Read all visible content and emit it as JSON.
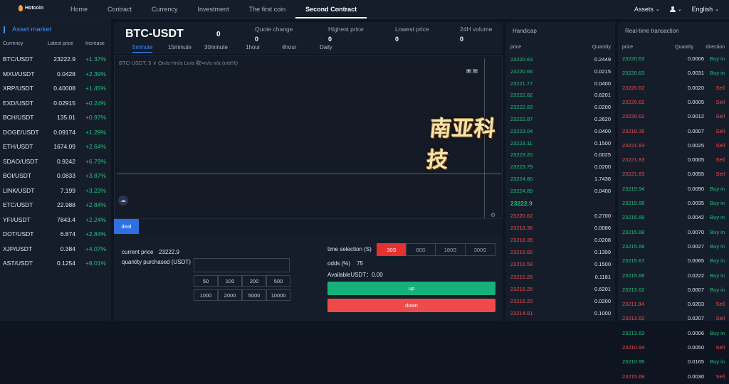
{
  "brand": {
    "name": "Hotcoin"
  },
  "nav": {
    "items": [
      "Home",
      "Contract",
      "Currency",
      "Investment",
      "The first coin",
      "Second Contract"
    ],
    "active": "Second Contract"
  },
  "topright": {
    "assets": "Assets",
    "language": "English"
  },
  "market": {
    "title": "Asset market",
    "headers": {
      "currency": "Currency",
      "price": "Latest price",
      "increase": "Increase"
    },
    "rows": [
      {
        "sym": "BTC/USDT",
        "price": "23222.9",
        "chg": "+1.37%"
      },
      {
        "sym": "MXU/USDT",
        "price": "0.0428",
        "chg": "+2.39%"
      },
      {
        "sym": "XRP/USDT",
        "price": "0.40008",
        "chg": "+1.45%"
      },
      {
        "sym": "EXD/USDT",
        "price": "0.02915",
        "chg": "+0.24%"
      },
      {
        "sym": "BCH/USDT",
        "price": "135.01",
        "chg": "+0.97%"
      },
      {
        "sym": "DOGE/USDT",
        "price": "0.09174",
        "chg": "+1.29%"
      },
      {
        "sym": "ETH/USDT",
        "price": "1674.09",
        "chg": "+2.64%"
      },
      {
        "sym": "SDAO/USDT",
        "price": "0.9242",
        "chg": "+6.79%"
      },
      {
        "sym": "BOI/USDT",
        "price": "0.0833",
        "chg": "+3.87%"
      },
      {
        "sym": "LINK/USDT",
        "price": "7.199",
        "chg": "+3.23%"
      },
      {
        "sym": "ETC/USDT",
        "price": "22.988",
        "chg": "+2.84%"
      },
      {
        "sym": "YFI/USDT",
        "price": "7843.4",
        "chg": "+2.24%"
      },
      {
        "sym": "DOT/USDT",
        "price": "6.874",
        "chg": "+2.84%"
      },
      {
        "sym": "XJP/USDT",
        "price": "0.384",
        "chg": "+4.07%"
      },
      {
        "sym": "AST/USDT",
        "price": "0.1254",
        "chg": "+8.01%"
      }
    ]
  },
  "header": {
    "pair": "BTC-USDT",
    "value": "0",
    "stats": [
      {
        "label": "Quote change",
        "value": "0"
      },
      {
        "label": "Highest price",
        "value": "0"
      },
      {
        "label": "Lowest price",
        "value": "0"
      },
      {
        "label": "24H volume",
        "value": "0"
      }
    ],
    "timeframes": [
      "5minute",
      "15minute",
      "30minute",
      "1hour",
      "4hour",
      "Daily"
    ],
    "active_tf": "5minute"
  },
  "chart": {
    "info": "BTC-USDT, 5 ∨   On/a  Hn/a  Ln/a  收=n/a  n/a (n/a%)"
  },
  "watermark": {
    "text": "南亚科技"
  },
  "deal": {
    "tab": "deal",
    "current_price_label": "current price",
    "current_price": "23222.9",
    "qty_label": "quantity purchased (USDT)",
    "qty_value": "",
    "quick": [
      "50",
      "100",
      "200",
      "500",
      "1000",
      "2000",
      "5000",
      "10000"
    ],
    "time_label": "time selection (S)",
    "times": [
      "30S",
      "60S",
      "180S",
      "300S"
    ],
    "active_time": "30S",
    "odds_label": "odds (%)",
    "odds": "75",
    "available": "AvailableUSDT：0.00",
    "up": "up",
    "down": "down"
  },
  "handicap": {
    "title": "Handicap",
    "headers": {
      "price": "price",
      "qty": "Quantity"
    },
    "bids": [
      {
        "price": "23220.63",
        "qty": "0.2449"
      },
      {
        "price": "23220.66",
        "qty": "0.0215"
      },
      {
        "price": "23221.77",
        "qty": "0.0400"
      },
      {
        "price": "23222.82",
        "qty": "0.6201"
      },
      {
        "price": "23222.83",
        "qty": "0.0200"
      },
      {
        "price": "23222.87",
        "qty": "0.2620"
      },
      {
        "price": "23223.04",
        "qty": "0.0400"
      },
      {
        "price": "23223.11",
        "qty": "0.1500"
      },
      {
        "price": "23223.20",
        "qty": "0.0025"
      },
      {
        "price": "23223.79",
        "qty": "0.0200"
      },
      {
        "price": "23224.80",
        "qty": "1.7438"
      },
      {
        "price": "23224.89",
        "qty": "0.0400"
      }
    ],
    "current": "23222.9",
    "asks": [
      {
        "price": "23220.62",
        "qty": "0.2700"
      },
      {
        "price": "23218.36",
        "qty": "0.0086"
      },
      {
        "price": "23218.35",
        "qty": "0.0208"
      },
      {
        "price": "23216.82",
        "qty": "0.1399"
      },
      {
        "price": "23216.59",
        "qty": "0.1500"
      },
      {
        "price": "23215.26",
        "qty": "0.1181"
      },
      {
        "price": "23215.25",
        "qty": "0.6201"
      },
      {
        "price": "23215.20",
        "qty": "0.0200"
      },
      {
        "price": "23214.81",
        "qty": "0.1000"
      }
    ]
  },
  "realtime": {
    "title": "Real-time transaction",
    "headers": {
      "price": "price",
      "qty": "Quantity",
      "dir": "direction"
    },
    "rows": [
      {
        "price": "23220.63",
        "qty": "0.0006",
        "dir": "Buy in",
        "side": "buy"
      },
      {
        "price": "23220.63",
        "qty": "0.0031",
        "dir": "Buy in",
        "side": "buy"
      },
      {
        "price": "23220.62",
        "qty": "0.0020",
        "dir": "Sell",
        "side": "sell"
      },
      {
        "price": "23220.62",
        "qty": "0.0005",
        "dir": "Sell",
        "side": "sell"
      },
      {
        "price": "23220.62",
        "qty": "0.0012",
        "dir": "Sell",
        "side": "sell"
      },
      {
        "price": "23218.35",
        "qty": "0.0007",
        "dir": "Sell",
        "side": "sell"
      },
      {
        "price": "23221.83",
        "qty": "0.0025",
        "dir": "Sell",
        "side": "sell"
      },
      {
        "price": "23221.83",
        "qty": "0.0005",
        "dir": "Sell",
        "side": "sell"
      },
      {
        "price": "23221.83",
        "qty": "0.0055",
        "dir": "Sell",
        "side": "sell"
      },
      {
        "price": "23219.94",
        "qty": "0.0090",
        "dir": "Buy in",
        "side": "buy"
      },
      {
        "price": "23215.68",
        "qty": "0.0035",
        "dir": "Buy in",
        "side": "buy"
      },
      {
        "price": "23215.68",
        "qty": "0.0042",
        "dir": "Buy in",
        "side": "buy"
      },
      {
        "price": "23215.68",
        "qty": "0.0070",
        "dir": "Buy in",
        "side": "buy"
      },
      {
        "price": "23215.68",
        "qty": "0.0027",
        "dir": "Buy in",
        "side": "buy"
      },
      {
        "price": "23215.67",
        "qty": "0.0065",
        "dir": "Buy in",
        "side": "buy"
      },
      {
        "price": "23215.68",
        "qty": "0.0222",
        "dir": "Buy in",
        "side": "buy"
      },
      {
        "price": "23213.62",
        "qty": "0.0007",
        "dir": "Buy in",
        "side": "buy"
      },
      {
        "price": "23211.84",
        "qty": "0.0203",
        "dir": "Sell",
        "side": "sell"
      },
      {
        "price": "23213.62",
        "qty": "0.0207",
        "dir": "Sell",
        "side": "sell"
      },
      {
        "price": "23213.63",
        "qty": "0.0006",
        "dir": "Buy in",
        "side": "buy"
      },
      {
        "price": "23210.94",
        "qty": "0.0050",
        "dir": "Sell",
        "side": "sell"
      },
      {
        "price": "23210.95",
        "qty": "0.0165",
        "dir": "Buy in",
        "side": "buy"
      },
      {
        "price": "23215.68",
        "qty": "0.0030",
        "dir": "Sell",
        "side": "sell"
      }
    ]
  },
  "colors": {
    "up": "#21c17a",
    "down": "#ef4a4a",
    "accent": "#3d8cff"
  }
}
